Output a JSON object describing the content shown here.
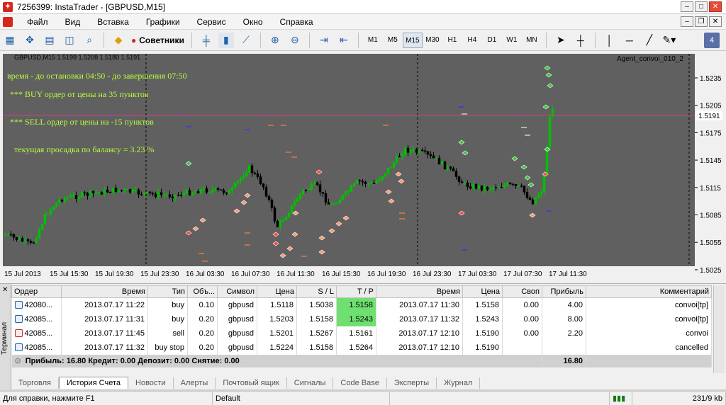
{
  "window": {
    "title": "7256399: InstaTrader - [GBPUSD,M15]"
  },
  "menu": [
    "Файл",
    "Вид",
    "Вставка",
    "Графики",
    "Сервис",
    "Окно",
    "Справка"
  ],
  "toolbar": {
    "advisors_label": "Советники",
    "timeframes": [
      "M1",
      "M5",
      "M15",
      "M30",
      "H1",
      "H4",
      "D1",
      "W1",
      "MN"
    ],
    "active_timeframe": "M15"
  },
  "chart": {
    "header": "GBPUSD,M15  1.5199 1.5208 1.5180 1.5191",
    "ea_name": "Agent_convoi_010_2",
    "texts": [
      "время - до остановки 04:50 - до завершения 07:50",
      "*** BUY ордер от цены на 35 пунктов",
      "*** SELL ордер от цены на -15 пунктов",
      "текущая просадка по балансу =  3.23 %"
    ],
    "price_labels": [
      "1.5235",
      "1.5205",
      "1.5175",
      "1.5145",
      "1.5115",
      "1.5085",
      "1.5055",
      "1.5025"
    ],
    "current_price": "1.5191",
    "time_labels": [
      "15 Jul 2013",
      "15 Jul 15:30",
      "15 Jul 19:30",
      "15 Jul 23:30",
      "16 Jul 03:30",
      "16 Jul 07:30",
      "16 Jul 11:30",
      "16 Jul 15:30",
      "16 Jul 19:30",
      "16 Jul 23:30",
      "17 Jul 03:30",
      "17 Jul 07:30",
      "17 Jul 11:30"
    ],
    "colors": {
      "background": "#606060",
      "bull": "#00c000",
      "bear": "#000000",
      "price_line": "#c04080",
      "text": "#b7ff3a"
    }
  },
  "terminal": {
    "label": "Терминал",
    "columns": [
      "Ордер",
      "Время",
      "Тип",
      "Объ...",
      "Символ",
      "Цена",
      "S / L",
      "T / P",
      "Время",
      "Цена",
      "Своп",
      "Прибыль",
      "Комментарий"
    ],
    "rows": [
      {
        "order": "42080...",
        "open_time": "2013.07.17 11:22",
        "type": "buy",
        "volume": "0.10",
        "symbol": "gbpusd",
        "price": "1.5118",
        "sl": "1.5038",
        "tp": "1.5158",
        "close_time": "2013.07.17 11:30",
        "close_price": "1.5158",
        "swap": "0.00",
        "profit": "4.00",
        "comment": "convoi[tp]"
      },
      {
        "order": "42085...",
        "open_time": "2013.07.17 11:31",
        "type": "buy",
        "volume": "0.20",
        "symbol": "gbpusd",
        "price": "1.5203",
        "sl": "1.5158",
        "tp": "1.5243",
        "close_time": "2013.07.17 11:32",
        "close_price": "1.5243",
        "swap": "0.00",
        "profit": "8.00",
        "comment": "convoi[tp]"
      },
      {
        "order": "42085...",
        "open_time": "2013.07.17 11:45",
        "type": "sell",
        "volume": "0.20",
        "symbol": "gbpusd",
        "price": "1.5201",
        "sl": "1.5267",
        "tp": "1.5161",
        "close_time": "2013.07.17 12:10",
        "close_price": "1.5190",
        "swap": "0.00",
        "profit": "2.20",
        "comment": "convoi"
      },
      {
        "order": "42085...",
        "open_time": "2013.07.17 11:32",
        "type": "buy stop",
        "volume": "0.20",
        "symbol": "gbpusd",
        "price": "1.5224",
        "sl": "1.5158",
        "tp": "1.5264",
        "close_time": "2013.07.17 12:10",
        "close_price": "1.5190",
        "swap": "",
        "profit": "",
        "comment": "cancelled"
      }
    ],
    "summary": {
      "text": "Прибыль: 16.80  Кредит: 0.00  Депозит: 0.00  Снятие: 0.00",
      "total": "16.80"
    },
    "tabs": [
      "Торговля",
      "История Счета",
      "Новости",
      "Алерты",
      "Почтовый ящик",
      "Сигналы",
      "Code Base",
      "Эксперты",
      "Журнал"
    ],
    "active_tab": "История Счета"
  },
  "status": {
    "help": "Для справки, нажмите F1",
    "profile": "Default",
    "traffic": "231/9 kb"
  }
}
